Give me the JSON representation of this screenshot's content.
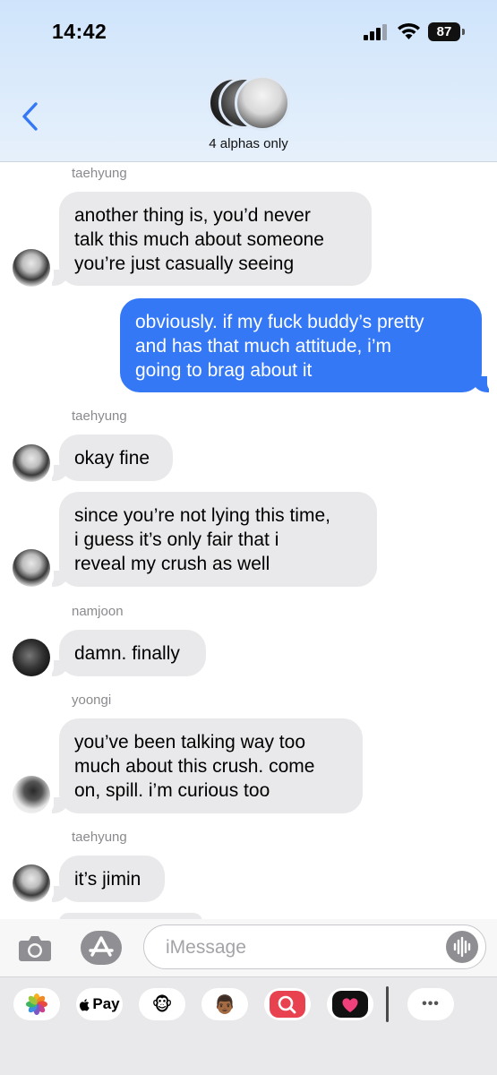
{
  "status": {
    "time": "14:42",
    "battery": "87"
  },
  "header": {
    "group_name": "4 alphas only"
  },
  "messages": [
    {
      "sender": "taehyung",
      "text": "another thing is, you’d never\ntalk this much about someone\nyou’re just casually seeing"
    },
    {
      "text": "obviously. if my fuck buddy’s pretty\nand has that much attitude, i’m\ngoing to brag about it"
    },
    {
      "sender": "taehyung",
      "text": "okay fine"
    },
    {
      "text": "since you’re not lying this time,\ni guess it’s only fair that i\nreveal my crush as well"
    },
    {
      "sender": "namjoon",
      "text": "damn. finally"
    },
    {
      "sender": "yoongi",
      "text": "you’ve been talking way too\nmuch about this crush. come\non, spill. i’m curious too"
    },
    {
      "sender": "taehyung",
      "text": "it’s jimin"
    }
  ],
  "compose": {
    "placeholder": "iMessage"
  },
  "drawer": {
    "apps": [
      {
        "name": "photos-icon"
      },
      {
        "name": "apple-pay-icon",
        "label": "Pay"
      },
      {
        "name": "memoji-monkey-icon",
        "glyph": "🐵"
      },
      {
        "name": "memoji-stickers-icon",
        "glyph": "👨🏾"
      },
      {
        "name": "image-search-icon"
      },
      {
        "name": "digital-touch-icon"
      },
      {
        "name": "more-apps-icon",
        "glyph": "•••"
      }
    ]
  },
  "colors": {
    "outgoing": "#3478f6",
    "incoming": "#e9e9eb",
    "header_tint": "#d6e8fb"
  }
}
